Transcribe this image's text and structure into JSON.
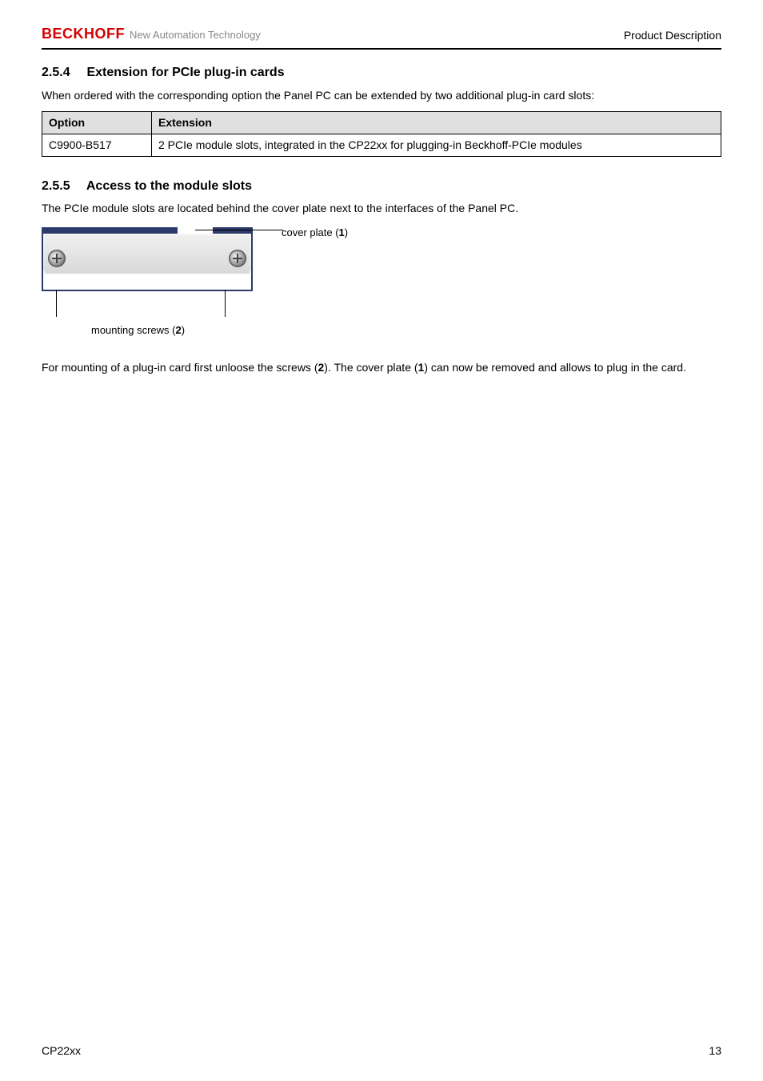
{
  "header": {
    "brand": "BECKHOFF",
    "brand_sub": "New Automation Technology",
    "right": "Product Description"
  },
  "sec254": {
    "num": "2.5.4",
    "title": "Extension for PCIe plug-in cards",
    "intro": "When ordered with the corresponding option the Panel PC can be extended by two additional plug-in card slots:"
  },
  "opt_table": {
    "th_option": "Option",
    "th_ext": "Extension",
    "rows": [
      {
        "opt": "C9900-B517",
        "ext": "2 PCIe module slots,  integrated in the CP22xx for plugging-in  Beckhoff-PCIe modules"
      }
    ]
  },
  "sec255": {
    "num": "2.5.5",
    "title": "Access to the module slots",
    "intro": "The PCIe module slots are located behind the cover plate next to the interfaces of the Panel PC."
  },
  "fig": {
    "cover_label_pre": "cover plate (",
    "cover_label_num": "1",
    "cover_label_post": ")",
    "screw_label_pre": "mounting screws (",
    "screw_label_num": "2",
    "screw_label_post": ")"
  },
  "para_mount": {
    "p1": "For mounting of a plug-in card first unloose the screws (",
    "b1": "2",
    "p2": "). The cover plate (",
    "b2": "1",
    "p3": ") can now be removed and allows to plug in the card."
  },
  "footer": {
    "left": "CP22xx",
    "right": "13"
  }
}
